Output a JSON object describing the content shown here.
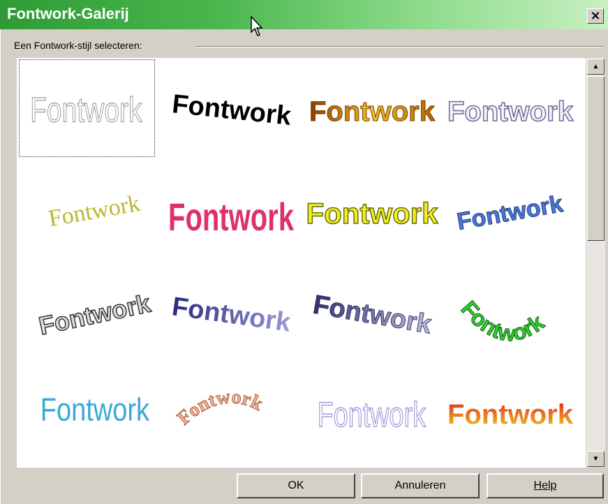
{
  "window": {
    "title": "Fontwork-Galerij",
    "close_label": "×"
  },
  "group": {
    "label": "Een Fontwork-stijl selecteren:"
  },
  "gallery": {
    "selected_index": 0,
    "items": [
      {
        "text": "Fontwork"
      },
      {
        "text": "Fontwork"
      },
      {
        "text": "Fontwork"
      },
      {
        "text": "Fontwork"
      },
      {
        "text": "Fontwork"
      },
      {
        "text": "Fontwork"
      },
      {
        "text": "Fontwork"
      },
      {
        "text": "Fontwork"
      },
      {
        "text": "Fontwork"
      },
      {
        "text": "Fontwork"
      },
      {
        "text": "Fontwork"
      },
      {
        "text": "Fontwork"
      },
      {
        "text": "Fontwork"
      },
      {
        "text": "Fontwork"
      },
      {
        "text": "Fontwork"
      },
      {
        "text": "Fontwork"
      }
    ]
  },
  "scrollbar": {
    "up_icon": "▲",
    "down_icon": "▼"
  },
  "buttons": {
    "ok": "OK",
    "cancel": "Annuleren",
    "help": "Help"
  },
  "colors": {
    "title_green": "#2e9b35",
    "dialog_bg": "#d4d0c8"
  }
}
